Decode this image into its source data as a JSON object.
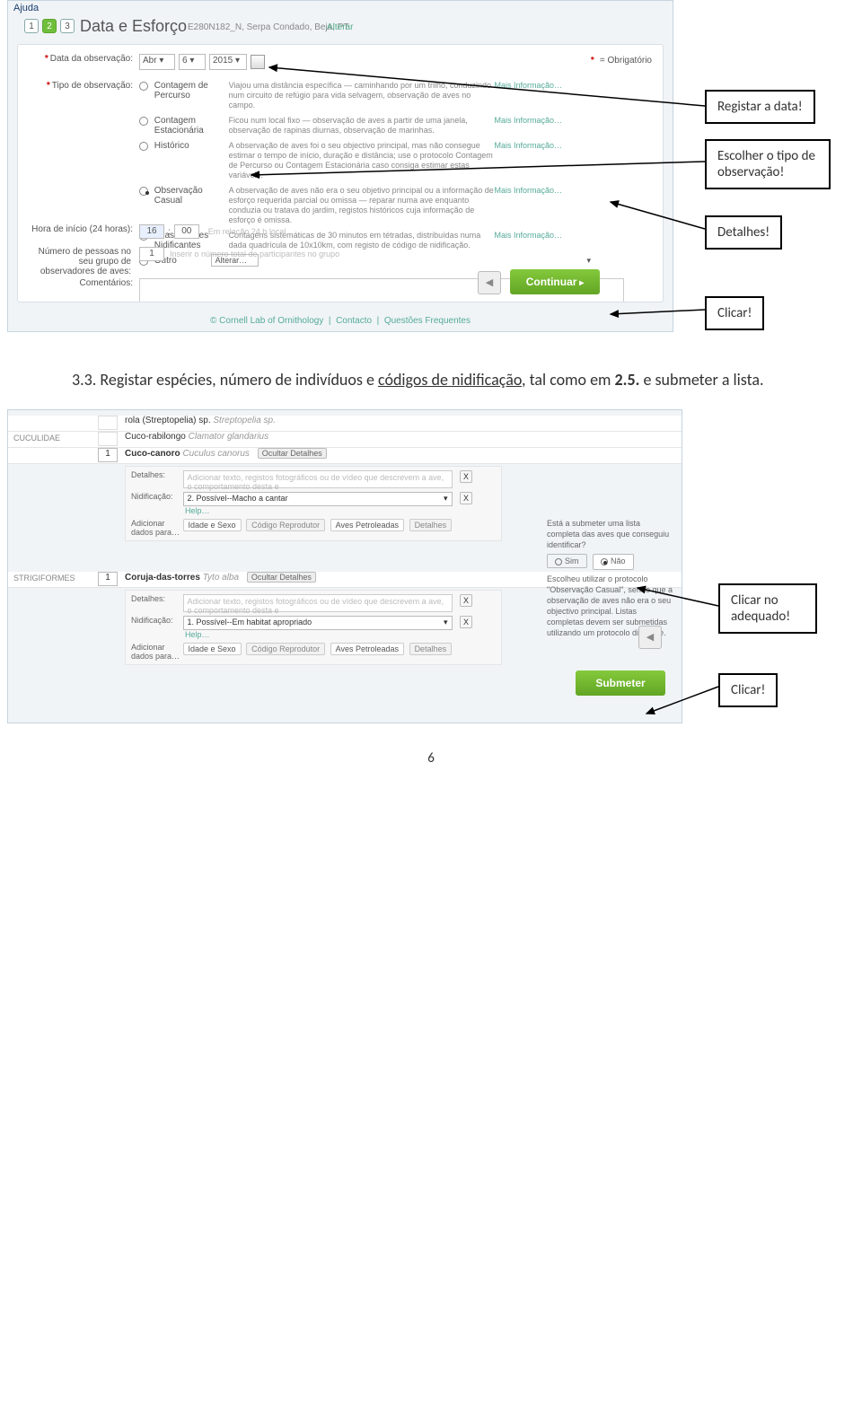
{
  "doc": {
    "para": "3.3. Registar espécies, número de indivíduos e ",
    "para_u": "códigos de nidificação",
    "para_2": ", tal como em ",
    "para_b": "2.5.",
    "para_3": " e submeter a lista.",
    "pagenum": "6"
  },
  "callouts": {
    "c1": "Registar a data!",
    "c2": "Escolher o tipo de observação!",
    "c3": "Detalhes!",
    "c4": "Clicar!",
    "c5": "Clicar no adequado!",
    "c6": "Clicar!"
  },
  "shot1": {
    "ajuda": "Ajuda",
    "steps": [
      "1",
      "2",
      "3"
    ],
    "title": "Data e Esforço",
    "loc": "E280N182_N, Serpa Condado, Beja, PT",
    "alterar": "Alterar",
    "obrig": "= Obrigatório",
    "lbl_date": "Data da observação:",
    "date_month": "Abr",
    "date_day": "6",
    "date_year": "2015",
    "lbl_type": "Tipo de observação:",
    "radios": [
      {
        "name": "Contagem de Percurso",
        "desc": "Viajou uma distância específica — caminhando por um trilho, conduzindo num circuito de refúgio para vida selvagem, observação de aves no campo."
      },
      {
        "name": "Contagem Estacionária",
        "desc": "Ficou num local fixo — observação de aves a partir de uma janela, observação de rapinas diurnas, observação de marinhas."
      },
      {
        "name": "Histórico",
        "desc": "A observação de aves foi o seu objectivo principal, mas não consegue estimar o tempo de início, duração e distância; use o protocolo Contagem de Percurso ou Contagem Estacionária caso consiga estimar estas variáveis."
      },
      {
        "name": "Observação Casual",
        "desc": "A observação de aves não era o seu objetivo principal ou a informação de esforço requerida parcial ou omissa — reparar numa ave enquanto conduzia ou tratava do jardim, registos históricos cuja informação de esforço é omissa."
      },
      {
        "name": "Atlas da Aves Nidificantes",
        "desc": "Contagens sistemáticas de 30 minutos em tétradas, distribuídas numa dada quadrícula de 10x10km, com registo de código de nidificação."
      },
      {
        "name": "Outro",
        "desc": ""
      }
    ],
    "mais": "Mais Informação…",
    "outro_sel": "Alterar…",
    "lbl_hora": "Hora de início (24 horas):",
    "hora_h": "16",
    "hora_m": "00",
    "hora_hint": "Em relação 24 h local",
    "lbl_pessoas": "Número de pessoas no seu grupo de observadores de aves:",
    "pessoas_val": "1",
    "pessoas_hint": "Inserir o número total de participantes no grupo",
    "lbl_com": "Comentários:",
    "continue": "Continuar",
    "footer_a": "© Cornell Lab of Ornithology",
    "footer_b": "Contacto",
    "footer_c": "Questões Frequentes"
  },
  "shot2": {
    "sp0": "rola (Streptopelia) sp.",
    "sp0_sci": "Streptopelia sp.",
    "fam1": "CUCULIDAE",
    "sp1": "Cuco-rabilongo",
    "sp1_sci": "Clamator glandarius",
    "sp2": "Cuco-canoro",
    "sp2_sci": "Cuculus canorus",
    "hide": "Ocultar Detalhes",
    "det": "Detalhes:",
    "det_ph": "Adicionar texto, registos fotográficos ou de vídeo que descrevem a ave, o comportamento desta e",
    "nid": "Nidificação:",
    "nid_sel1": "2. Possível--Macho a cantar",
    "help": "Help…",
    "addfor": "Adicionar dados para…",
    "pill1": "Idade e Sexo",
    "pill2": "Código Reprodutor",
    "pill3": "Aves Petroleadas",
    "pill4": "Detalhes",
    "fam2": "STRIGIFORMES",
    "sp3": "Coruja-das-torres",
    "sp3_sci": "Tyto alba",
    "nid_sel2": "1. Possível--Em habitat apropriado",
    "cnt1": "1",
    "cnt2": "1",
    "right_title": "Está a submeter uma lista completa das aves que conseguiu identificar?",
    "sim": "Sim",
    "nao": "Não",
    "right_body": "Escolheu utilizar o protocolo \"Observação Casual\", sendo que a observação de aves não era o seu objectivo principal. Listas completas devem ser submetidas utilizando um protocolo diferente.",
    "submeter": "Submeter"
  }
}
